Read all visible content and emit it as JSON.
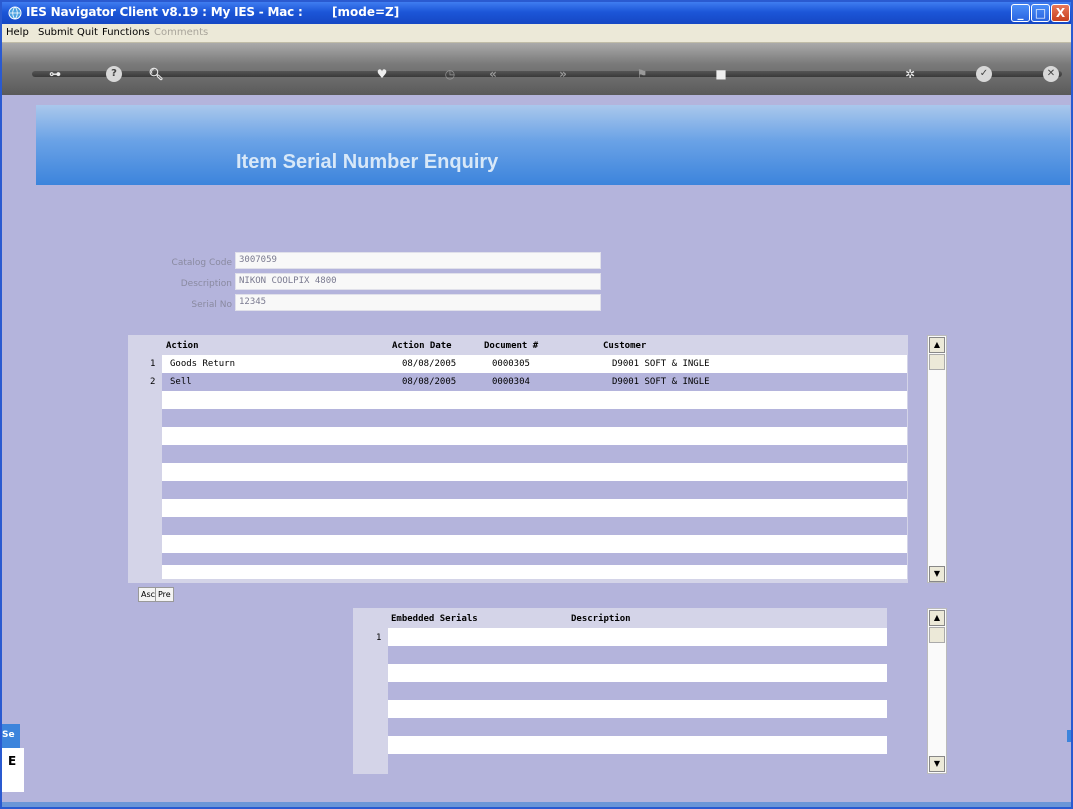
{
  "window": {
    "title": "IES Navigator Client v8.19 : My IES - Mac :",
    "mode": "[mode=Z]",
    "minimize": "_",
    "maximize": "□",
    "close": "X"
  },
  "menu": {
    "items": [
      "Help",
      "Submit",
      "Quit",
      "Functions"
    ],
    "disabled": "Comments"
  },
  "toolbar": {
    "icons": [
      "key-icon",
      "help-icon",
      "search-icon",
      "heart-icon",
      "clock-icon",
      "rewind-icon",
      "fast-forward-icon",
      "flag-icon",
      "stop-icon",
      "gear-icon",
      "check-icon",
      "close-icon"
    ]
  },
  "banner": {
    "heading": "Item Serial Number Enquiry"
  },
  "fields": {
    "catalog_label": "Catalog Code",
    "catalog_value": "3007059",
    "description_label": "Description",
    "description_value": "NIKON COOLPIX 4800",
    "serial_label": "Serial No",
    "serial_value": "12345"
  },
  "grid1": {
    "headers": {
      "action": "Action",
      "action_date": "Action Date",
      "document": "Document #",
      "customer": "Customer"
    },
    "rows": [
      {
        "num": "1",
        "action": "Goods Return",
        "date": "08/08/2005",
        "doc": "0000305",
        "customer": "D9001 SOFT & INGLE"
      },
      {
        "num": "2",
        "action": "Sell",
        "date": "08/08/2005",
        "doc": "0000304",
        "customer": "D9001 SOFT & INGLE"
      }
    ],
    "scroll_up": "▲",
    "scroll_down": "▼"
  },
  "buttons": {
    "asc": "Asc",
    "pre": "Pre"
  },
  "grid2": {
    "headers": {
      "embedded": "Embedded Serials",
      "description": "Description"
    },
    "first_row_num": "1",
    "scroll_up": "▲",
    "scroll_down": "▼"
  },
  "side": {
    "frag_top": "Se",
    "frag_bottom": "E"
  },
  "colors": {
    "title_blue": "#1c56d8",
    "banner_blue": "#6aa2e6",
    "bg_lavender": "#b4b4dc"
  }
}
